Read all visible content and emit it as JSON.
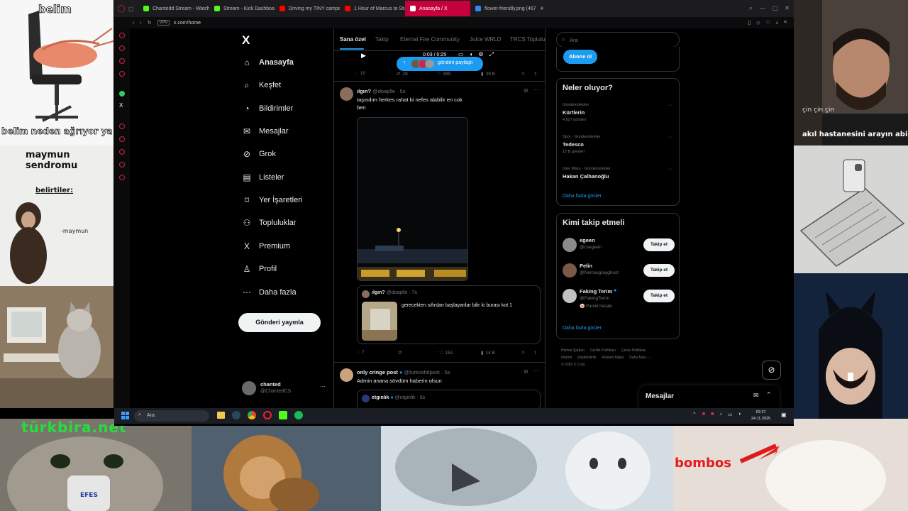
{
  "overlays": {
    "shrimp_top": "belim",
    "shrimp_bottom": "belim neden ağrıyor ya",
    "monkey_title": "maymun sendromu",
    "monkey_label": "belirtiler:",
    "monkey_sign": "-maymun",
    "webcam_caption1": "çin çin çin",
    "webcam_caption2": "akıl hastanesini arayın abi",
    "cat_banner": "türkbira.net",
    "cat_cup": "EFES",
    "bombos": "bombos"
  },
  "browser": {
    "tabs": [
      {
        "label": "Chantedd Stream - Watch",
        "color": "#53fc18"
      },
      {
        "label": "Stream - Kick Dashboard",
        "color": "#53fc18"
      },
      {
        "label": "Driving my TINY camper",
        "color": "#ff0000"
      },
      {
        "label": "1 Hour of Marcus to Stud",
        "color": "#ff0000"
      },
      {
        "label": "Anasayfa / X",
        "color": "#ffffff"
      },
      {
        "label": "flower-friendly.png (467...",
        "color": "#3b82f6"
      }
    ],
    "vpn_badge": "VPN",
    "url": "x.com/home"
  },
  "x_nav": {
    "logo": "X",
    "items": [
      {
        "label": "Anasayfa",
        "icon": "home-icon"
      },
      {
        "label": "Keşfet",
        "icon": "search-icon"
      },
      {
        "label": "Bildirimler",
        "icon": "bell-icon"
      },
      {
        "label": "Mesajlar",
        "icon": "mail-icon"
      },
      {
        "label": "Grok",
        "icon": "grok-icon"
      },
      {
        "label": "Listeler",
        "icon": "list-icon"
      },
      {
        "label": "Yer İşaretleri",
        "icon": "bookmark-icon"
      },
      {
        "label": "Topluluklar",
        "icon": "people-icon"
      },
      {
        "label": "Premium",
        "icon": "x-icon"
      },
      {
        "label": "Profil",
        "icon": "person-icon"
      },
      {
        "label": "Daha fazla",
        "icon": "more-icon"
      }
    ],
    "post_button": "Gönderi yayınla",
    "account_name": "chanted",
    "account_handle": "@ChantedCS",
    "account_more": "···"
  },
  "feed": {
    "tabs": [
      "Sana özel",
      "Takip",
      "Eternal Fire Community",
      "Juice WRLD",
      "TRCS Topluluk"
    ],
    "toast": "gönderi paylaştı",
    "video_time": "0:03 / 0:25",
    "prev_actions": {
      "replies": "10",
      "reposts": "28",
      "likes": "890",
      "views": "39 B"
    },
    "tweet1": {
      "name": "ılgın?",
      "handle": "@doaplle · 5s",
      "text": "taşındım herkes rahat bi nefes alabilir en cok ben",
      "quote_name": "ılgın?",
      "quote_handle": "@doaplle · 7s",
      "quote_text": "gerecekten sıfırdan başlayanlar bilir ki burası kot 1",
      "replies": "7",
      "reposts": "",
      "likes": "152",
      "views": "14 B"
    },
    "tweet2": {
      "name": "only cringe post",
      "handle": "@turkoshitpost · 5s",
      "text": "Admin anana sövdüm haberin olsun",
      "sub_name": "etgınlık",
      "sub_handle": "@etginlik · 6s"
    }
  },
  "right": {
    "search_placeholder": "Ara",
    "subscribe": "Abone ol",
    "trends_title": "Neler oluyor?",
    "trends": [
      {
        "context": "Gündemdekiler",
        "topic": "Kürtlerin",
        "count": "4.827 gönderi"
      },
      {
        "context": "Spor · Gündemdekiler",
        "topic": "Tedesco",
        "count": "12 B gönderi"
      },
      {
        "context": "Inter Milan · Gündemdekiler",
        "topic": "Hakan Çalhanoğlu",
        "count": ""
      }
    ],
    "show_more": "Daha fazla göster",
    "follow_title": "Kimi takip etmeli",
    "follow": [
      {
        "name": "egeen",
        "handle": "@csegeen",
        "extra": ""
      },
      {
        "name": "Pelin",
        "handle": "@Nerraograyghost",
        "extra": ""
      },
      {
        "name": "Faking Terim",
        "handle": "@FakingTerim",
        "extra": "🤡 Parodi hesabı"
      }
    ],
    "follow_button": "Takip et",
    "footer": [
      "Hizmet Şartları",
      "Gizlilik Politikası",
      "Çerez Politikası",
      "Imprint",
      "Erişilebilirlik",
      "Reklam bilgisi",
      "Daha fazla ···",
      "© 2025 X Corp."
    ],
    "messages": "Mesajlar"
  },
  "taskbar": {
    "search": "Ara",
    "time": "02:27",
    "date": "24.11.2025"
  },
  "colors": {
    "x_blue": "#1d9bf0",
    "tab_active": "#c5003c",
    "opera_red": "#d1243f"
  }
}
